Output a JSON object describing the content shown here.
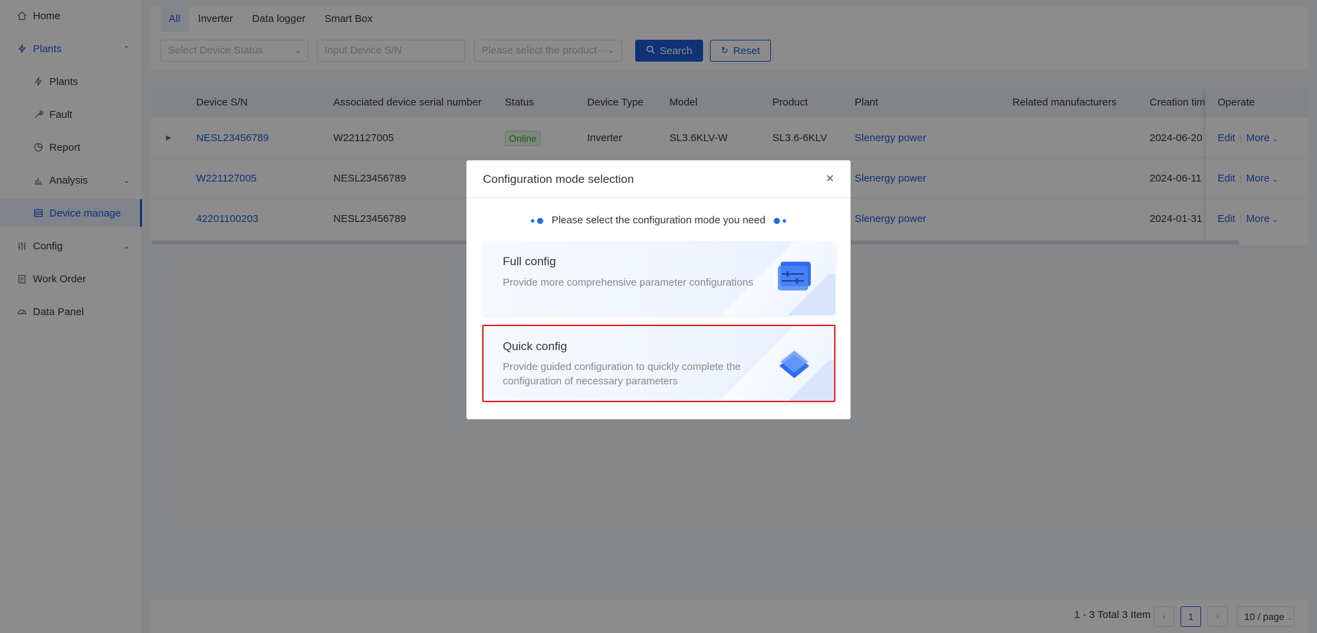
{
  "sidebar": {
    "items": [
      {
        "label": "Home",
        "icon": "home-icon"
      },
      {
        "label": "Plants",
        "icon": "bolt-icon"
      },
      {
        "label": "Plants",
        "icon": "bolt-icon"
      },
      {
        "label": "Fault",
        "icon": "wrench-icon"
      },
      {
        "label": "Report",
        "icon": "pie-chart-icon"
      },
      {
        "label": "Analysis",
        "icon": "bar-chart-icon"
      },
      {
        "label": "Device manage",
        "icon": "list-icon"
      },
      {
        "label": "Config",
        "icon": "sliders-icon"
      },
      {
        "label": "Work Order",
        "icon": "clipboard-icon"
      },
      {
        "label": "Data Panel",
        "icon": "dashboard-icon"
      }
    ]
  },
  "tabs": [
    "All",
    "Inverter",
    "Data logger",
    "Smart Box"
  ],
  "filters": {
    "status_placeholder": "Select Device Status",
    "sn_placeholder": "Input Device S/N",
    "product_placeholder": "Please select the product···",
    "search_label": "Search",
    "reset_label": "Reset"
  },
  "table": {
    "columns": [
      "Device S/N",
      "Associated device serial number",
      "Status",
      "Device Type",
      "Model",
      "Product",
      "Plant",
      "Related manufacturers",
      "Creation tim",
      "Operate"
    ],
    "rows": [
      {
        "sn": "NESL23456789",
        "assoc": "W221127005",
        "status": "Online",
        "type": "Inverter",
        "model": "SL3.6KLV-W",
        "product": "SL3.6-6KLV",
        "plant": "Slenergy power",
        "manufacturer": "",
        "created": "2024-06-20"
      },
      {
        "sn": "W221127005",
        "assoc": "NESL23456789",
        "status": "",
        "type": "",
        "model": "",
        "product": "",
        "plant": "Slenergy power",
        "manufacturer": "",
        "created": "2024-06-11"
      },
      {
        "sn": "42201100203",
        "assoc": "NESL23456789",
        "status": "",
        "type": "",
        "model": "",
        "product": "",
        "plant": "Slenergy power",
        "manufacturer": "",
        "created": "2024-01-31"
      }
    ],
    "edit_label": "Edit",
    "more_label": "More"
  },
  "pagination": {
    "total": "1 - 3 Total 3 Item",
    "current": "1",
    "page_size": "10 / page"
  },
  "modal": {
    "title": "Configuration mode selection",
    "hint": "Please select the configuration mode you need",
    "full": {
      "title": "Full config",
      "desc": "Provide more comprehensive parameter configurations"
    },
    "quick": {
      "title": "Quick config",
      "desc": "Provide guided configuration to quickly complete the configuration of necessary parameters"
    }
  },
  "colors": {
    "accent": "#1e5bd8",
    "highlight": "#e02020",
    "online": "#3aa23a"
  }
}
